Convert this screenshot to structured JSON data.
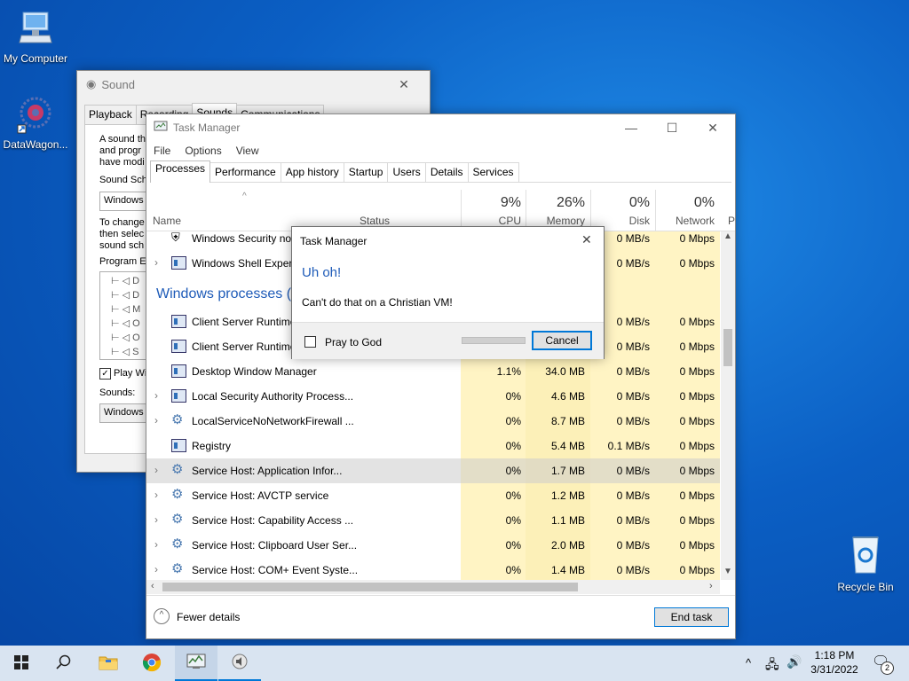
{
  "desktop": {
    "icons": [
      {
        "label": "My Computer"
      },
      {
        "label": "DataWagon..."
      },
      {
        "label": "Recycle Bin"
      }
    ]
  },
  "sound_window": {
    "title": "Sound",
    "tabs": [
      "Playback",
      "Recording",
      "Sounds",
      "Communications"
    ],
    "active_tab": "Sounds",
    "desc_lines": [
      "A sound th",
      "and progr",
      "have modi"
    ],
    "scheme_label": "Sound Sch",
    "scheme_value": "Windows",
    "change_lines": [
      "To change",
      "then selec",
      "sound sch"
    ],
    "program_events_label": "Program E",
    "event_items": [
      "D",
      "D",
      "M",
      "O",
      "O",
      "S"
    ],
    "play_windows_label": "Play Wi",
    "sounds_label": "Sounds:",
    "sounds_value": "Windows"
  },
  "task_manager": {
    "title": "Task Manager",
    "menu": [
      "File",
      "Options",
      "View"
    ],
    "tabs": [
      "Processes",
      "Performance",
      "App history",
      "Startup",
      "Users",
      "Details",
      "Services"
    ],
    "active_tab": "Processes",
    "columns": {
      "name": "Name",
      "status": "Status",
      "cpu_pct": "9%",
      "cpu": "CPU",
      "mem_pct": "26%",
      "mem": "Memory",
      "disk_pct": "0%",
      "disk": "Disk",
      "net_pct": "0%",
      "net": "Network",
      "extra": "P"
    },
    "top_rows": [
      {
        "name": "Windows Security not",
        "disk": "0 MB/s",
        "net": "0 Mbps"
      },
      {
        "name": "Windows Shell Experi",
        "disk": "0 MB/s",
        "net": "0 Mbps"
      }
    ],
    "group_header": "Windows processes (8",
    "rows": [
      {
        "name": "Client Server Runtime",
        "cpu": "",
        "mem": "",
        "disk": "0 MB/s",
        "net": "0 Mbps",
        "icon": "window",
        "expand": false
      },
      {
        "name": "Client Server Runtime",
        "cpu": "",
        "mem": "",
        "disk": "0 MB/s",
        "net": "0 Mbps",
        "icon": "window",
        "expand": false
      },
      {
        "name": "Desktop Window Manager",
        "cpu": "1.1%",
        "mem": "34.0 MB",
        "disk": "0 MB/s",
        "net": "0 Mbps",
        "icon": "window",
        "expand": false
      },
      {
        "name": "Local Security Authority Process...",
        "cpu": "0%",
        "mem": "4.6 MB",
        "disk": "0 MB/s",
        "net": "0 Mbps",
        "icon": "window",
        "expand": true
      },
      {
        "name": "LocalServiceNoNetworkFirewall ...",
        "cpu": "0%",
        "mem": "8.7 MB",
        "disk": "0 MB/s",
        "net": "0 Mbps",
        "icon": "gear",
        "expand": true
      },
      {
        "name": "Registry",
        "cpu": "0%",
        "mem": "5.4 MB",
        "disk": "0.1 MB/s",
        "net": "0 Mbps",
        "icon": "window",
        "expand": false
      },
      {
        "name": "Service Host: Application Infor...",
        "cpu": "0%",
        "mem": "1.7 MB",
        "disk": "0 MB/s",
        "net": "0 Mbps",
        "icon": "gear",
        "expand": true,
        "selected": true
      },
      {
        "name": "Service Host: AVCTP service",
        "cpu": "0%",
        "mem": "1.2 MB",
        "disk": "0 MB/s",
        "net": "0 Mbps",
        "icon": "gear",
        "expand": true
      },
      {
        "name": "Service Host: Capability Access ...",
        "cpu": "0%",
        "mem": "1.1 MB",
        "disk": "0 MB/s",
        "net": "0 Mbps",
        "icon": "gear",
        "expand": true
      },
      {
        "name": "Service Host: Clipboard User Ser...",
        "cpu": "0%",
        "mem": "2.0 MB",
        "disk": "0 MB/s",
        "net": "0 Mbps",
        "icon": "gear",
        "expand": true
      },
      {
        "name": "Service Host: COM+ Event Syste...",
        "cpu": "0%",
        "mem": "1.4 MB",
        "disk": "0 MB/s",
        "net": "0 Mbps",
        "icon": "gear",
        "expand": true
      }
    ],
    "fewer_details": "Fewer details",
    "end_task": "End task"
  },
  "dialog": {
    "title": "Task Manager",
    "heading": "Uh oh!",
    "message": "Can't do that on a Christian VM!",
    "checkbox_label": "Pray to God",
    "cancel": "Cancel"
  },
  "taskbar": {
    "time": "1:18 PM",
    "date": "3/31/2022",
    "notification_count": "2"
  },
  "colors": {
    "accent": "#0078d7",
    "heading_blue": "#1e5bb8",
    "usage_yellow": "#fff4c4"
  }
}
